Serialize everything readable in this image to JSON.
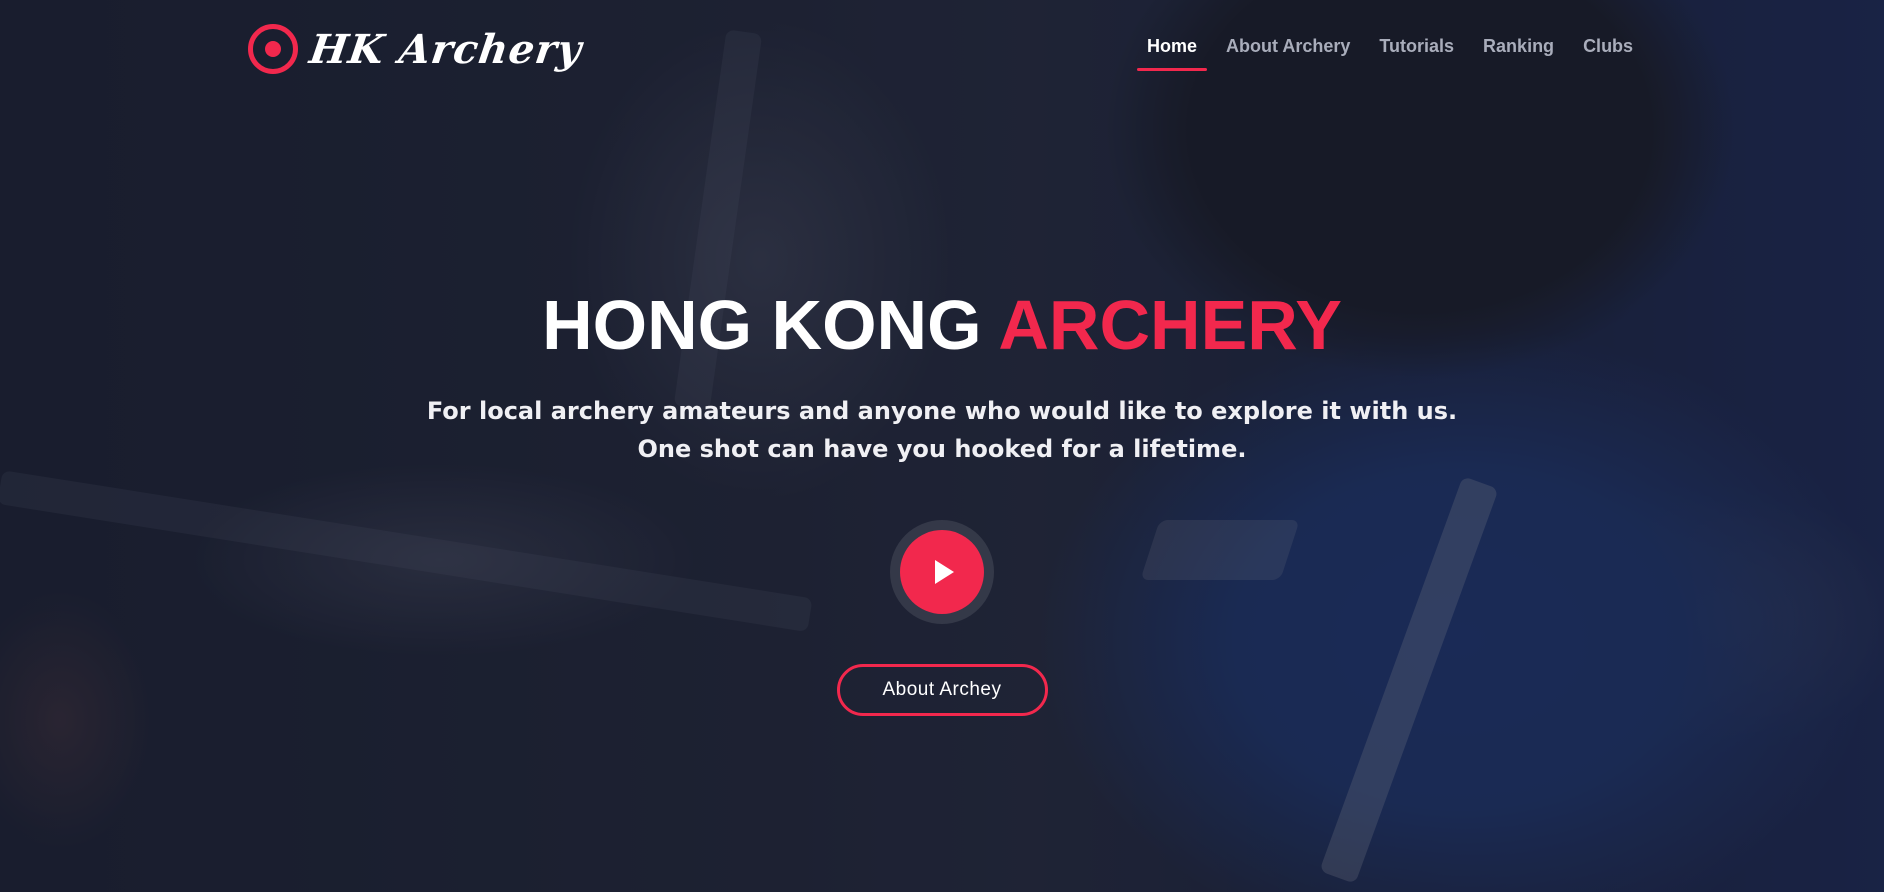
{
  "brand": {
    "name": "HK Archery",
    "icon": "target-icon"
  },
  "nav": {
    "items": [
      {
        "label": "Home",
        "active": true
      },
      {
        "label": "About Archery",
        "active": false
      },
      {
        "label": "Tutorials",
        "active": false
      },
      {
        "label": "Ranking",
        "active": false
      },
      {
        "label": "Clubs",
        "active": false
      }
    ]
  },
  "hero": {
    "title_main": "HONG KONG",
    "title_accent": "ARCHERY",
    "subtitle_line1": "For local archery amateurs and anyone who would like to explore it with us.",
    "subtitle_line2": "One shot can have you hooked for a lifetime.",
    "play_icon": "play-icon",
    "cta_label": "About Archey"
  },
  "colors": {
    "accent": "#f2284d",
    "nav_inactive": "#a9adbb",
    "text": "#ffffff"
  }
}
